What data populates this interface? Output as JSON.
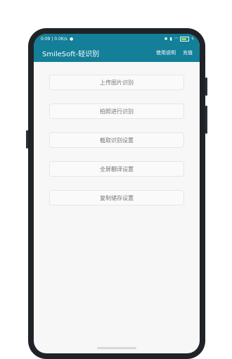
{
  "statusbar": {
    "time": "0:09 | 0.0K/s",
    "battery": "100",
    "icons": [
      "bluetooth-icon",
      "signal-icon",
      "wifi-icon",
      "battery-icon"
    ]
  },
  "appbar": {
    "title": "SmileSoft-轻识别",
    "actions": [
      "使用说明",
      "充值"
    ]
  },
  "buttons": [
    {
      "label": "上传图片识别"
    },
    {
      "label": "拍照进行识别"
    },
    {
      "label": "截取识别设置"
    },
    {
      "label": "全屏翻译设置"
    },
    {
      "label": "复制储存设置"
    }
  ],
  "colors": {
    "primary": "#137f98",
    "background": "#f7f7f7",
    "bezel": "#1f2327"
  }
}
